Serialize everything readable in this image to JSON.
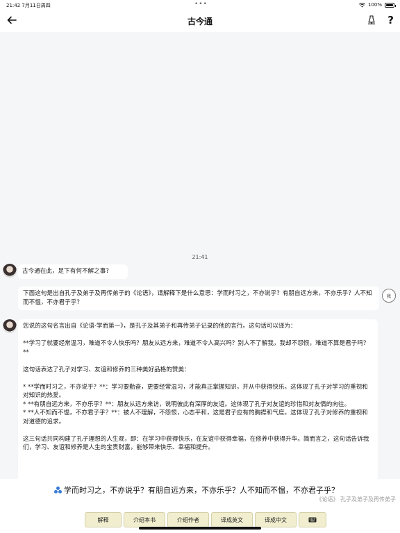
{
  "status_bar": {
    "time_date": "21:42  7月11日周四",
    "dots": "•••",
    "battery": "100%"
  },
  "nav": {
    "title": "古今通",
    "back_icon": "arrow-left-icon",
    "lamp_icon": "lamp-icon",
    "help": "?"
  },
  "chat": {
    "timestamp": "21:41",
    "bot_greeting": "古今通在此，足下有何不解之事?",
    "user_message": "下面这句是出自孔子及弟子及再传弟子的《论语》，请解释下是什么意思：学而时习之，不亦说乎？有朋自远方来，不亦乐乎？人不知而不愠，不亦君子乎？",
    "user_avatar_label": "我",
    "bot_reply": {
      "p1": "您说的这句名言出自《论语·学而第一》，是孔子及其弟子和再传弟子记录的他的言行。这句话可以译为：",
      "p2": "**学习了就要经常温习，难道不令人快乐吗？朋友从远方来，难道不令人高兴吗？别人不了解我，我却不怨恨，难道不算是君子吗？**",
      "p3": "这句话表达了孔子对学习、友谊和修养的三种美好品格的赞美：",
      "b1": "* **学而时习之，不亦说乎？**：学习要勤奋，更要经常温习，才能真正掌握知识，并从中获得快乐。这体现了孔子对学习的重视和对知识的热爱。",
      "b2": "* **有朋自远方来，不亦乐乎？**：朋友从远方来访，说明彼此有深厚的友谊。这体现了孔子对友谊的珍惜和对友情的向往。",
      "b3": "* **人不知而不愠，不亦君子乎？**：被人不理解，不怨恨，心态平和，这是君子应有的胸襟和气度。这体现了孔子对修养的重视和对道德的追求。",
      "p4": "这三句话共同构建了孔子理想的人生观，即：在学习中获得快乐，在友谊中获得幸福，在修养中获得升华。简而言之，这句话告诉我们，学习、友谊和修养是人生的宝贵财富，能够带来快乐、幸福和提升。"
    }
  },
  "suggestion": {
    "quote": "学而时习之，不亦说乎？有朋自远方来，不亦乐乎？人不知而不愠，不亦君子乎？",
    "source": "《论语》 孔子及弟子及再传弟子"
  },
  "toolbar": {
    "buttons": [
      "解释",
      "介绍本书",
      "介绍作者",
      "译成英文",
      "译成中文"
    ],
    "keyboard_icon": "keyboard-icon"
  }
}
